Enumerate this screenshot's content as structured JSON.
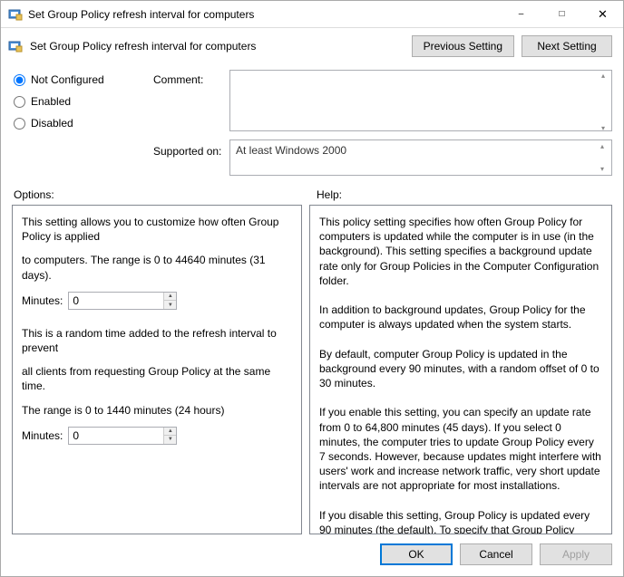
{
  "window": {
    "title": "Set Group Policy refresh interval for computers"
  },
  "header": {
    "title": "Set Group Policy refresh interval for computers",
    "prev": "Previous Setting",
    "next": "Next Setting"
  },
  "state": {
    "not_configured": "Not Configured",
    "enabled": "Enabled",
    "disabled": "Disabled",
    "selected": "not_configured"
  },
  "labels": {
    "comment": "Comment:",
    "supported": "Supported on:",
    "options": "Options:",
    "help": "Help:",
    "minutes": "Minutes:"
  },
  "comment": "",
  "supported_on": "At least Windows 2000",
  "options": {
    "intro1": "This setting allows you to customize how often Group Policy is applied",
    "intro2": "to computers. The range is 0 to 44640 minutes (31 days).",
    "minutesA": "0",
    "mid1": "This is a random time added to the refresh interval to prevent",
    "mid2": "all clients from requesting Group Policy at the same time.",
    "mid3": "The range is 0 to 1440 minutes (24 hours)",
    "minutesB": "0"
  },
  "help_text": "This policy setting specifies how often Group Policy for computers is updated while the computer is in use (in the background). This setting specifies a background update rate only for Group Policies in the Computer Configuration folder.\n\nIn addition to background updates, Group Policy for the computer is always updated when the system starts.\n\nBy default, computer Group Policy is updated in the background every 90 minutes, with a random offset of 0 to 30 minutes.\n\nIf you enable this setting, you can specify an update rate from 0 to 64,800 minutes (45 days). If you select 0 minutes, the computer tries to update Group Policy every 7 seconds. However, because updates might interfere with users' work and increase network traffic, very short update intervals are not appropriate for most installations.\n\nIf you disable this setting, Group Policy is updated every 90 minutes (the default). To specify that Group Policy should never be updated while the computer is in use, select the \"Turn off",
  "footer": {
    "ok": "OK",
    "cancel": "Cancel",
    "apply": "Apply"
  }
}
